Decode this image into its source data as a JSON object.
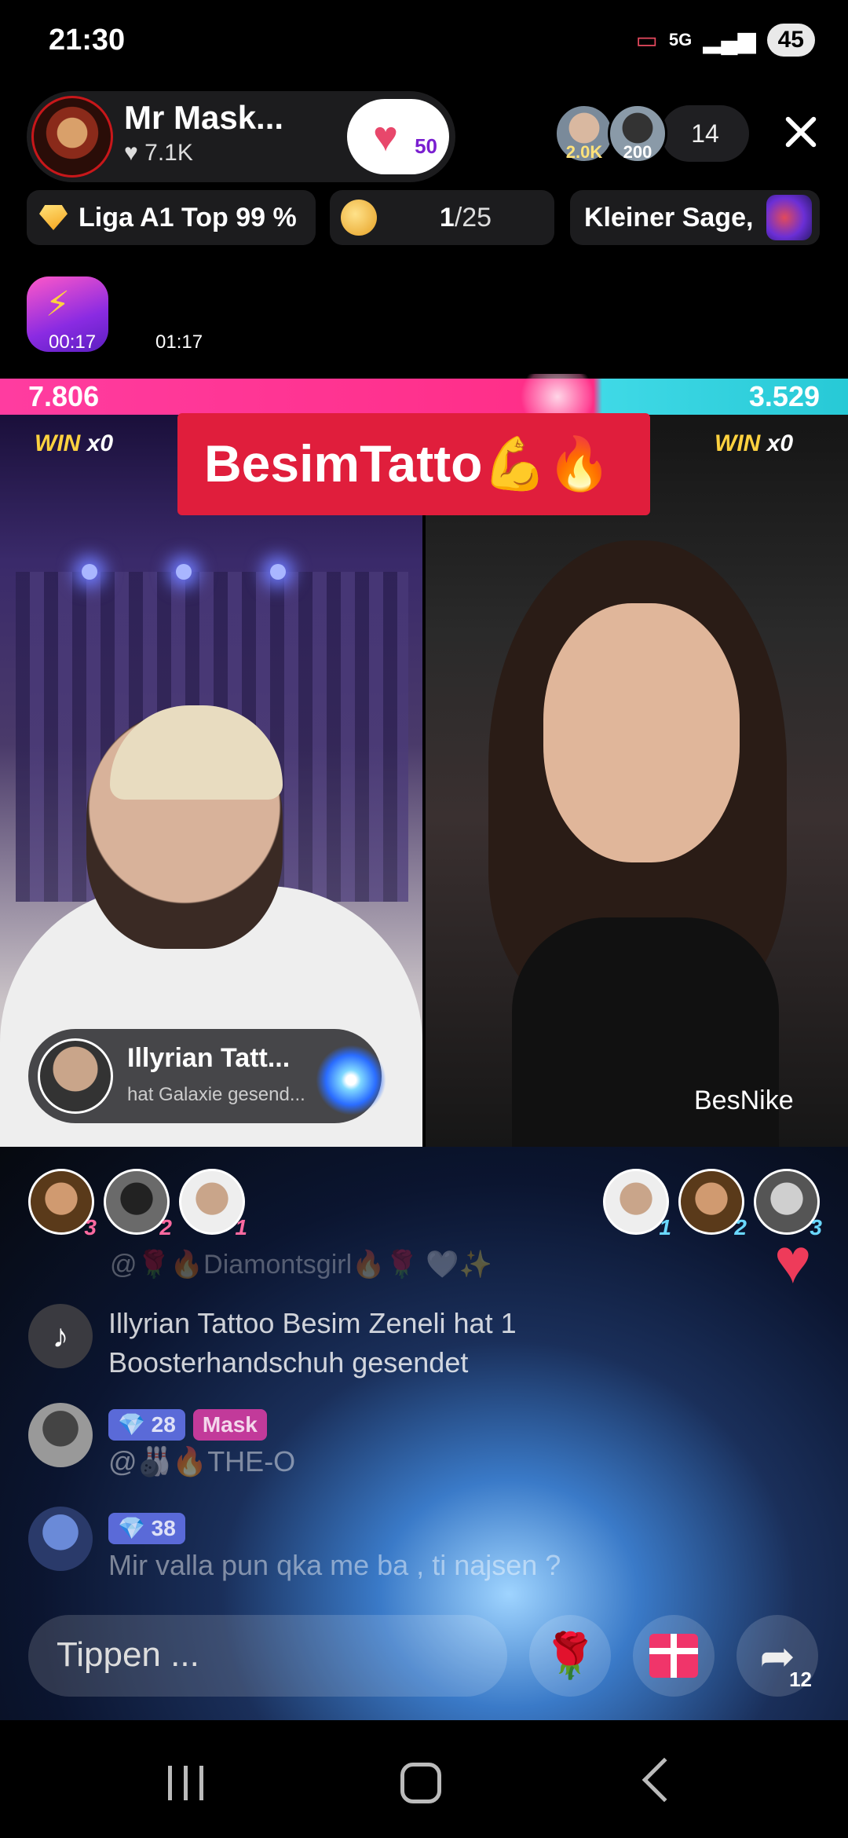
{
  "status_bar": {
    "time": "21:30",
    "network": "5G",
    "battery": "45"
  },
  "host": {
    "name": "Mr Mask...",
    "likes": "7.1K",
    "fan_level": "50"
  },
  "viewers": {
    "top1": "2.0K",
    "top2": "200",
    "count": "14"
  },
  "pills": {
    "league": "Liga A1 Top 99 %",
    "rank_current": "1",
    "rank_total": "/25",
    "sage": "Kleiner Sage,"
  },
  "timers": {
    "boost_timer": "00:17",
    "battle_timer": "01:17"
  },
  "battle": {
    "score_left": "7.806",
    "score_right": "3.529",
    "win_left_label": "WIN",
    "win_left_count": "x0",
    "win_right_label": "WIN",
    "win_right_count": "x0",
    "banner": "BesimTatto💪🔥",
    "right_name": "BesNike"
  },
  "gift_toast": {
    "name": "Illyrian Tatt...",
    "sub": "hat Galaxie gesend..."
  },
  "left_ranks": [
    "3",
    "2",
    "1"
  ],
  "right_ranks": [
    "1",
    "2",
    "3"
  ],
  "chat": {
    "faded_line": "@🌹🔥Diamontsgirl🔥🌹 🤍✨",
    "system_line1": "Illyrian Tattoo Besim Zeneli hat 1",
    "system_line2": "Boosterhandschuh gesendet",
    "msg1_level": "28",
    "msg1_badge": "Mask",
    "msg1_text": "@🎳🔥THE-O",
    "msg2_level": "38",
    "msg2_text": "Mir valla pun qka me ba , ti najsen ?"
  },
  "input": {
    "placeholder": "Tippen ..."
  },
  "share_count": "12",
  "colors": {
    "battle_left": "#ff2d86",
    "battle_right": "#27c9d6",
    "banner": "#e01e3c",
    "win": "#ffd23f"
  }
}
